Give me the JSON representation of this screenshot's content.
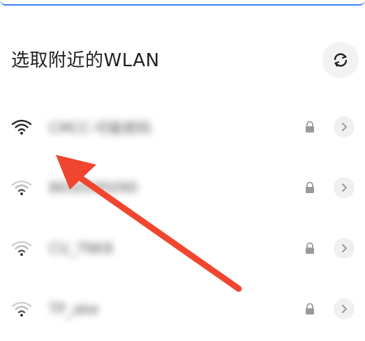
{
  "header": {
    "title": "选取附近的WLAN"
  },
  "accent_color": "#3f7ef0",
  "annotation_arrow_color": "#f0462f",
  "networks": [
    {
      "ssid": "CMCC-可能密码",
      "signal": "full",
      "secured": true
    },
    {
      "ssid": "8650595090",
      "signal": "medium",
      "secured": true
    },
    {
      "ssid": "CU_7NK8",
      "signal": "medium",
      "secured": true
    },
    {
      "ssid": "TP_abe",
      "signal": "medium",
      "secured": true
    }
  ]
}
